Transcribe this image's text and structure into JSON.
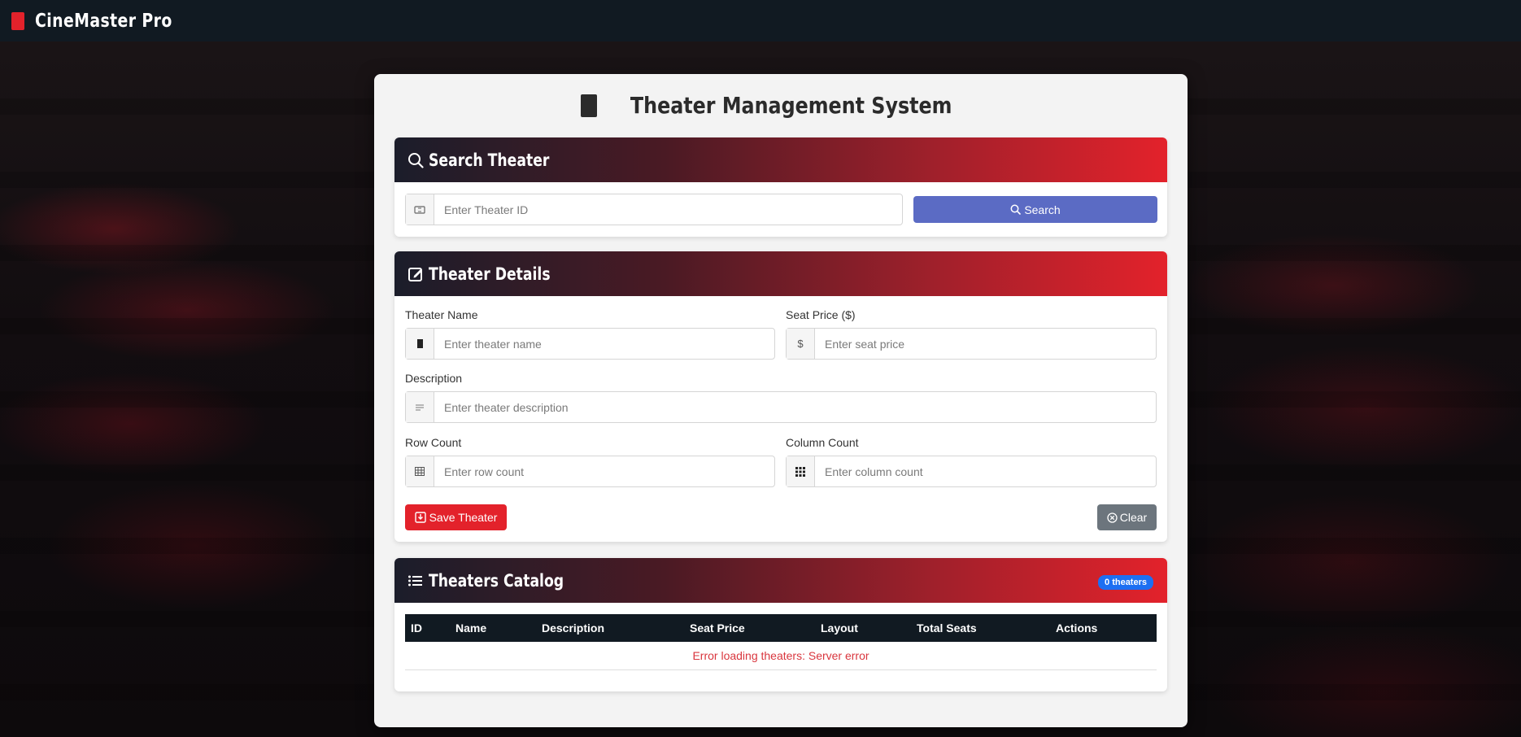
{
  "app": {
    "name": "CineMaster Pro"
  },
  "page": {
    "title": "Theater Management System"
  },
  "search_card": {
    "title": "Search Theater",
    "input_placeholder": "Enter Theater ID",
    "button_label": "Search"
  },
  "details_card": {
    "title": "Theater Details",
    "name_label": "Theater Name",
    "name_placeholder": "Enter theater name",
    "price_label": "Seat Price ($)",
    "price_addon": "$",
    "price_placeholder": "Enter seat price",
    "description_label": "Description",
    "description_placeholder": "Enter theater description",
    "rows_label": "Row Count",
    "rows_placeholder": "Enter row count",
    "columns_label": "Column Count",
    "columns_placeholder": "Enter column count",
    "save_label": "Save Theater",
    "clear_label": "Clear"
  },
  "catalog_card": {
    "title": "Theaters Catalog",
    "badge": "0 theaters",
    "columns": [
      "ID",
      "Name",
      "Description",
      "Seat Price",
      "Layout",
      "Total Seats",
      "Actions"
    ],
    "error_message": "Error loading theaters: Server error"
  },
  "colors": {
    "accent": "#e3222b",
    "search_button": "#5b6bc4",
    "clear_button": "#6c757d",
    "navbar": "#111a22",
    "badge": "#1d6ff2",
    "error_text": "#d9363e"
  }
}
